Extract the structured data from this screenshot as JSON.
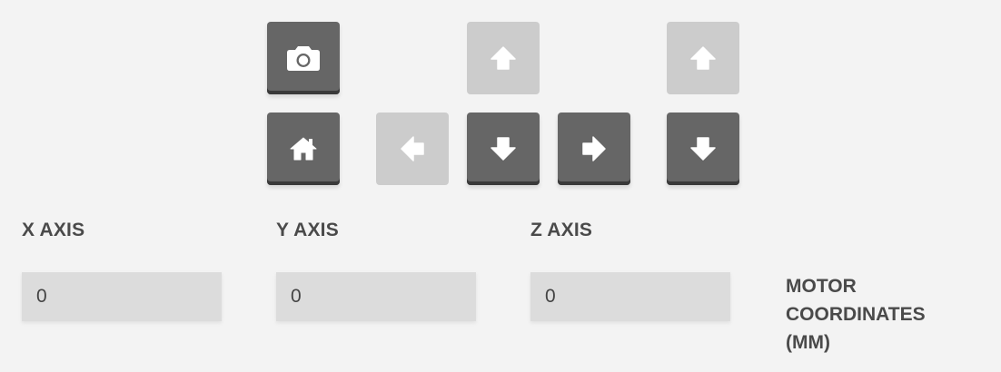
{
  "buttons": {
    "camera": {
      "icon": "camera-icon",
      "enabled": true
    },
    "home": {
      "icon": "home-icon",
      "enabled": true
    },
    "y_up": {
      "icon": "arrow-up-icon",
      "enabled": false
    },
    "x_left": {
      "icon": "arrow-left-icon",
      "enabled": false
    },
    "y_down": {
      "icon": "arrow-down-icon",
      "enabled": true
    },
    "x_right": {
      "icon": "arrow-right-icon",
      "enabled": true
    },
    "z_up": {
      "icon": "arrow-up-icon",
      "enabled": false
    },
    "z_down": {
      "icon": "arrow-down-icon",
      "enabled": true
    }
  },
  "axes": {
    "x": {
      "label": "X AXIS",
      "value": "0"
    },
    "y": {
      "label": "Y AXIS",
      "value": "0"
    },
    "z": {
      "label": "Z AXIS",
      "value": "0"
    }
  },
  "motor_coordinates_label": "MOTOR COORDINATES (MM)",
  "colors": {
    "background": "#f3f3f3",
    "button_enabled": "#666666",
    "button_disabled": "#cccccc",
    "input_background": "#dcdcdc",
    "label_text": "#4a4a4a"
  }
}
